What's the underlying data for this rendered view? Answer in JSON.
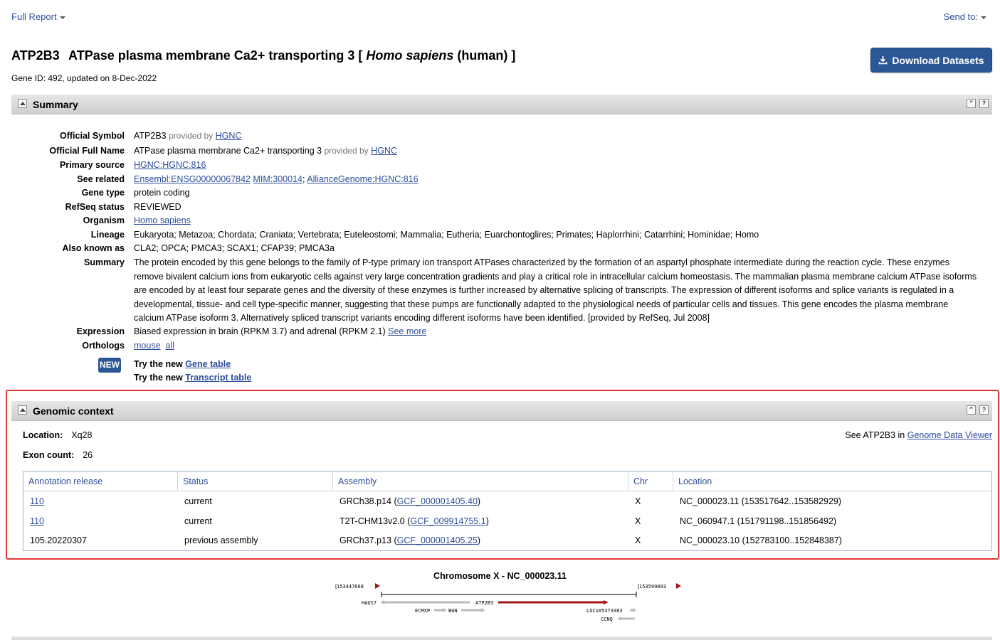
{
  "topbar": {
    "full_report": "Full Report",
    "send_to": "Send to:"
  },
  "gene": {
    "symbol": "ATP2B3",
    "name_prefix": "ATPase plasma membrane Ca2+ transporting 3 [",
    "organism_italic": "Homo sapiens",
    "name_suffix": "(human) ]",
    "id_line": "Gene ID: 492, updated on 8-Dec-2022",
    "download_label": "Download Datasets"
  },
  "summary": {
    "title": "Summary",
    "official_symbol_label": "Official Symbol",
    "official_symbol": "ATP2B3",
    "provided_by": "provided by",
    "hgnc": "HGNC",
    "official_full_name_label": "Official Full Name",
    "official_full_name": "ATPase plasma membrane Ca2+ transporting 3",
    "primary_source_label": "Primary source",
    "primary_source": "HGNC:HGNC:816",
    "see_related_label": "See related",
    "see_related": [
      "Ensembl:ENSG00000067842",
      "MIM:300014",
      "AllianceGenome:HGNC:816"
    ],
    "gene_type_label": "Gene type",
    "gene_type": "protein coding",
    "refseq_status_label": "RefSeq status",
    "refseq_status": "REVIEWED",
    "organism_label": "Organism",
    "organism": "Homo sapiens",
    "lineage_label": "Lineage",
    "lineage": "Eukaryota; Metazoa; Chordata; Craniata; Vertebrata; Euteleostomi; Mammalia; Eutheria; Euarchontoglires; Primates; Haplorrhini; Catarrhini; Hominidae; Homo",
    "aka_label": "Also known as",
    "aka": "CLA2; OPCA; PMCA3; SCAX1; CFAP39; PMCA3a",
    "summary_label": "Summary",
    "summary_text": "The protein encoded by this gene belongs to the family of P-type primary ion transport ATPases characterized by the formation of an aspartyl phosphate intermediate during the reaction cycle. These enzymes remove bivalent calcium ions from eukaryotic cells against very large concentration gradients and play a critical role in intracellular calcium homeostasis. The mammalian plasma membrane calcium ATPase isoforms are encoded by at least four separate genes and the diversity of these enzymes is further increased by alternative splicing of transcripts. The expression of different isoforms and splice variants is regulated in a developmental, tissue- and cell type-specific manner, suggesting that these pumps are functionally adapted to the physiological needs of particular cells and tissues. This gene encodes the plasma membrane calcium ATPase isoform 3. Alternatively spliced transcript variants encoding different isoforms have been identified. [provided by RefSeq, Jul 2008]",
    "expression_label": "Expression",
    "expression": "Biased expression in brain (RPKM 3.7) and adrenal (RPKM 2.1)",
    "see_more": "See more",
    "orthologs_label": "Orthologs",
    "orthologs": [
      "mouse",
      "all"
    ],
    "new_badge": "NEW",
    "try_prefix": "Try the new",
    "gene_table": "Gene table",
    "transcript_table": "Transcript table"
  },
  "genomic": {
    "title": "Genomic context",
    "location_label": "Location:",
    "location": "Xq28",
    "exon_label": "Exon count:",
    "exon": "26",
    "see_prefix": "See ATP2B3 in",
    "gdv": "Genome Data Viewer",
    "headers": [
      "Annotation release",
      "Status",
      "Assembly",
      "Chr",
      "Location"
    ],
    "rows": [
      {
        "release": "110",
        "status": "current",
        "assembly": "GRCh38.p14",
        "acc": "GCF_000001405.40",
        "chr": "X",
        "location": "NC_000023.11 (153517642..153582929)"
      },
      {
        "release": "110",
        "status": "current",
        "assembly": "T2T-CHM13v2.0",
        "acc": "GCF_009914755.1",
        "chr": "X",
        "location": "NC_060947.1 (151791198..151856492)"
      },
      {
        "release": "105.20220307",
        "status": "previous assembly",
        "assembly": "GRCh37.p13",
        "acc": "GCF_000001405.25",
        "chr": "X",
        "location": "NC_000023.10 (152783100..152848387)"
      }
    ]
  },
  "chromosome": {
    "title": "Chromosome X - NC_000023.11",
    "left_coord": "153447668",
    "right_coord": "153599893",
    "genes": [
      "HAUS7",
      "ATP2B3",
      "ECMXP",
      "BGN",
      "LOC105373383",
      "CCNQ"
    ],
    "accent": "#a31515"
  }
}
